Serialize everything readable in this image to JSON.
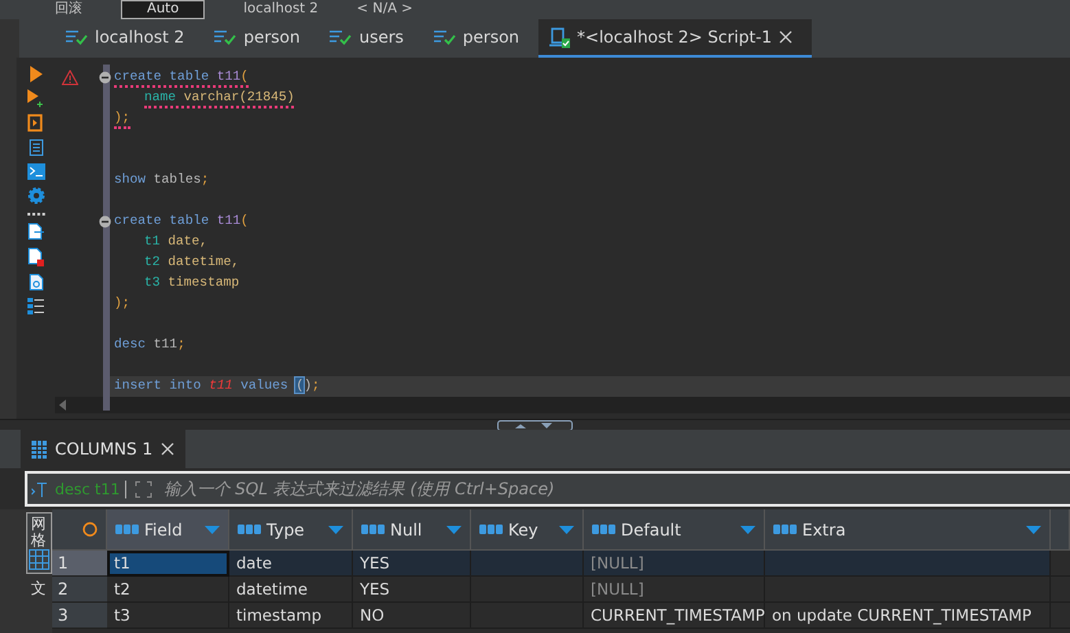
{
  "toolbar": {
    "items": [
      {
        "kind": "text",
        "text": "回滚"
      },
      {
        "kind": "field",
        "text": "Auto"
      },
      {
        "kind": "text",
        "text": "localhost 2"
      },
      {
        "kind": "text",
        "text": "< N/A >"
      }
    ]
  },
  "editor_tabs": [
    {
      "label": "localhost 2",
      "kind": "connection",
      "selected": false
    },
    {
      "label": "person",
      "kind": "connection",
      "selected": false
    },
    {
      "label": "users",
      "kind": "connection",
      "selected": false
    },
    {
      "label": "person",
      "kind": "connection",
      "selected": false
    },
    {
      "label": "*<localhost 2> Script-1",
      "kind": "script",
      "selected": true
    }
  ],
  "code_lines": [
    {
      "fold": true,
      "warning": true,
      "current": false,
      "text": {
        "squiggle": true,
        "kind": "statement",
        "tokens": [
          {
            "text": "create table ",
            "kind": "keyword"
          },
          {
            "text": "t11",
            "kind": "table"
          },
          {
            "text": "(",
            "kind": "punct"
          }
        ]
      }
    },
    {
      "fold": false,
      "warning": false,
      "current": false,
      "text": {
        "squiggle": true,
        "kind": "nested",
        "tokens": [
          {
            "text": "name ",
            "kind": "column"
          },
          {
            "text": "varchar(21845)",
            "kind": "type"
          }
        ]
      }
    },
    {
      "fold": false,
      "warning": false,
      "current": false,
      "text": {
        "squiggle": true,
        "kind": "statement",
        "tokens": [
          {
            "text": ");",
            "kind": "punct"
          }
        ]
      }
    },
    {
      "fold": false,
      "warning": false,
      "current": false
    },
    {
      "fold": false,
      "warning": false,
      "current": false
    },
    {
      "fold": false,
      "warning": false,
      "current": false,
      "text": {
        "squiggle": false,
        "kind": "statement",
        "tokens": [
          {
            "text": "show ",
            "kind": "keyword"
          },
          {
            "text": "tables",
            "kind": "plain"
          },
          {
            "text": ";",
            "kind": "punct"
          }
        ]
      }
    },
    {
      "fold": false,
      "warning": false,
      "current": false
    },
    {
      "fold": true,
      "warning": false,
      "current": false,
      "text": {
        "squiggle": false,
        "kind": "statement",
        "tokens": [
          {
            "text": "create table ",
            "kind": "keyword"
          },
          {
            "text": "t11",
            "kind": "table"
          },
          {
            "text": "(",
            "kind": "punct"
          }
        ]
      }
    },
    {
      "fold": false,
      "warning": false,
      "current": false,
      "text": {
        "squiggle": false,
        "kind": "nested",
        "tokens": [
          {
            "text": "t1 ",
            "kind": "column"
          },
          {
            "text": "date,",
            "kind": "type"
          }
        ]
      }
    },
    {
      "fold": false,
      "warning": false,
      "current": false,
      "text": {
        "squiggle": false,
        "kind": "nested",
        "tokens": [
          {
            "text": "t2 ",
            "kind": "column"
          },
          {
            "text": "datetime,",
            "kind": "type"
          }
        ]
      }
    },
    {
      "fold": false,
      "warning": false,
      "current": false,
      "text": {
        "squiggle": false,
        "kind": "nested",
        "tokens": [
          {
            "text": "t3 ",
            "kind": "column"
          },
          {
            "text": "timestamp",
            "kind": "type"
          }
        ]
      }
    },
    {
      "fold": false,
      "warning": false,
      "current": false,
      "text": {
        "squiggle": false,
        "kind": "statement",
        "tokens": [
          {
            "text": ");",
            "kind": "punct"
          }
        ]
      }
    },
    {
      "fold": false,
      "warning": false,
      "current": false
    },
    {
      "fold": false,
      "warning": false,
      "current": false,
      "text": {
        "squiggle": false,
        "kind": "statement",
        "tokens": [
          {
            "text": "desc ",
            "kind": "keyword"
          },
          {
            "text": "t11",
            "kind": "plain"
          },
          {
            "text": ";",
            "kind": "punct"
          }
        ]
      }
    },
    {
      "fold": false,
      "warning": false,
      "current": false
    },
    {
      "fold": false,
      "warning": false,
      "current": true,
      "text": {
        "squiggle": false,
        "kind": "statement",
        "tokens": [
          {
            "text": "insert into ",
            "kind": "keyword"
          },
          {
            "text": "t11",
            "kind": "bad-table"
          },
          {
            "text": " values ",
            "kind": "keyword"
          },
          {
            "text": "(",
            "kind": "match"
          },
          {
            "text": ")",
            "kind": "plain"
          },
          {
            "text": ";",
            "kind": "punct"
          }
        ]
      }
    }
  ],
  "results_tab": {
    "label": "COLUMNS 1",
    "selected": true
  },
  "filter": {
    "query": "desc t11",
    "placeholder": "输入一个 SQL 表达式来过滤结果 (使用 Ctrl+Space)"
  },
  "side_tabs": [
    {
      "label": "网格",
      "selected": true
    },
    {
      "label": "文",
      "selected": false
    }
  ],
  "table": {
    "columns": [
      "Field",
      "Type",
      "Null",
      "Key",
      "Default",
      "Extra"
    ],
    "rows": [
      {
        "num": "1",
        "selected": true,
        "cells": [
          {
            "text": "t1",
            "null": false
          },
          {
            "text": "date",
            "null": false
          },
          {
            "text": "YES",
            "null": false
          },
          {
            "null": false
          },
          {
            "text": "[NULL]",
            "null": true
          },
          {
            "null": false
          }
        ]
      },
      {
        "num": "2",
        "selected": false,
        "cells": [
          {
            "text": "t2",
            "null": false
          },
          {
            "text": "datetime",
            "null": false
          },
          {
            "text": "YES",
            "null": false
          },
          {
            "null": false
          },
          {
            "text": "[NULL]",
            "null": true
          },
          {
            "null": false
          }
        ]
      },
      {
        "num": "3",
        "selected": false,
        "cells": [
          {
            "text": "t3",
            "null": false
          },
          {
            "text": "timestamp",
            "null": false
          },
          {
            "text": "NO",
            "null": false
          },
          {
            "null": false
          },
          {
            "text": "CURRENT_TIMESTAMP",
            "null": false
          },
          {
            "text": "on update CURRENT_TIMESTAMP",
            "null": false
          }
        ]
      }
    ]
  }
}
